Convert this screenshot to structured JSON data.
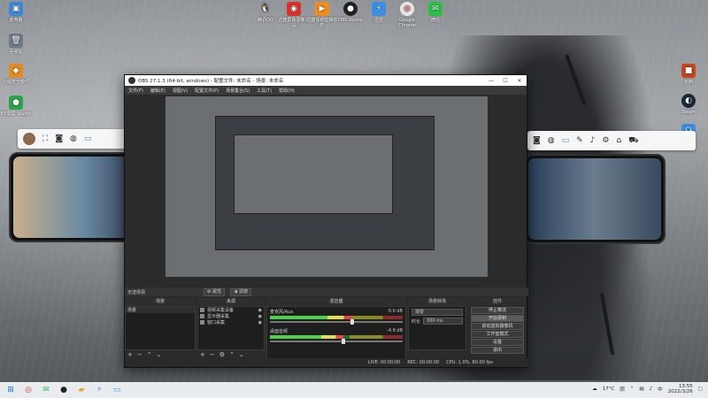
{
  "desktop": {
    "left_icons": [
      {
        "label": "此电脑",
        "icon": "computer-icon",
        "color": "#3b87d9",
        "glyph": "▣"
      },
      {
        "label": "回收站",
        "icon": "recycle-bin-icon",
        "color": "#6c7a86",
        "glyph": "🗑"
      },
      {
        "label": "火绒安全软件",
        "icon": "huorong-icon",
        "color": "#e58a1f",
        "glyph": "◆"
      },
      {
        "label": "EV录屏 Studio",
        "icon": "ev-recorder-icon",
        "color": "#2aa54a",
        "glyph": "●"
      }
    ],
    "top_icons": [
      {
        "label": "腾讯QQ",
        "icon": "qq-icon",
        "color": "#ffffff",
        "glyph": "🐧"
      },
      {
        "label": "迅捷屏幕录像工具",
        "icon": "recorder-icon",
        "color": "#d9312c",
        "glyph": "◉"
      },
      {
        "label": "迅捷视频剪辑软件",
        "icon": "video-editor-icon",
        "color": "#f28c1b",
        "glyph": "▶"
      },
      {
        "label": "OBS Studio",
        "icon": "obs-icon",
        "color": "#222222",
        "glyph": "●"
      },
      {
        "label": "迅雷",
        "icon": "thunder-icon",
        "color": "#3a8ee6",
        "glyph": "⚡"
      },
      {
        "label": "Google Chrome",
        "icon": "chrome-icon",
        "color": "#e8e8e8",
        "glyph": "◎"
      },
      {
        "label": "微信",
        "icon": "wechat-icon",
        "color": "#2bbf4a",
        "glyph": "✉"
      }
    ],
    "right_icons": [
      {
        "label": "定制",
        "icon": "custom-app-icon",
        "color": "#c8451d",
        "glyph": "■"
      },
      {
        "label": "Steam",
        "icon": "steam-icon",
        "color": "#1b2838",
        "glyph": "◐"
      },
      {
        "label": "",
        "icon": "headset-icon",
        "color": "#3a8ee6",
        "glyph": "☊"
      }
    ]
  },
  "obs": {
    "title": "OBS 27.1.3 (64-bit, windows) - 配置文件: 未命名 - 场景: 未命名",
    "menu": [
      "文件(F)",
      "编辑(E)",
      "视图(V)",
      "配置文件(P)",
      "场景集合(S)",
      "工具(T)",
      "帮助(H)"
    ],
    "dock_bar": {
      "label": "无选择源",
      "properties": "属性",
      "filters": "滤镜"
    },
    "panels": {
      "scenes": {
        "title": "场景",
        "items": [
          "场景"
        ]
      },
      "sources": {
        "title": "来源",
        "items": [
          "视频采集设备",
          "显示器采集",
          "窗口采集"
        ]
      },
      "mixer": {
        "title": "混音器",
        "channels": [
          {
            "name": "麦克风/Aux",
            "db": "0.0 dB",
            "level": 0.62
          },
          {
            "name": "桌面音频",
            "db": "-4.9 dB",
            "level": 0.55
          }
        ]
      },
      "transitions": {
        "title": "场景转场",
        "type": "渐变",
        "duration_label": "时长",
        "duration": "300 ms"
      },
      "controls": {
        "title": "控件",
        "buttons": [
          "停止推流",
          "开始录制",
          "启动虚拟摄像机",
          "工作室模式",
          "设置",
          "退出"
        ]
      }
    },
    "status": {
      "live": "LIVE: 00:00:00",
      "rec": "REC: 00:00:00",
      "cpu": "CPU: 1.0%, 60.00 fps"
    }
  },
  "taskbar": {
    "temp": "17°C",
    "weather": "阴",
    "ime": "中",
    "time": "13:55",
    "date": "2022/3/26"
  }
}
